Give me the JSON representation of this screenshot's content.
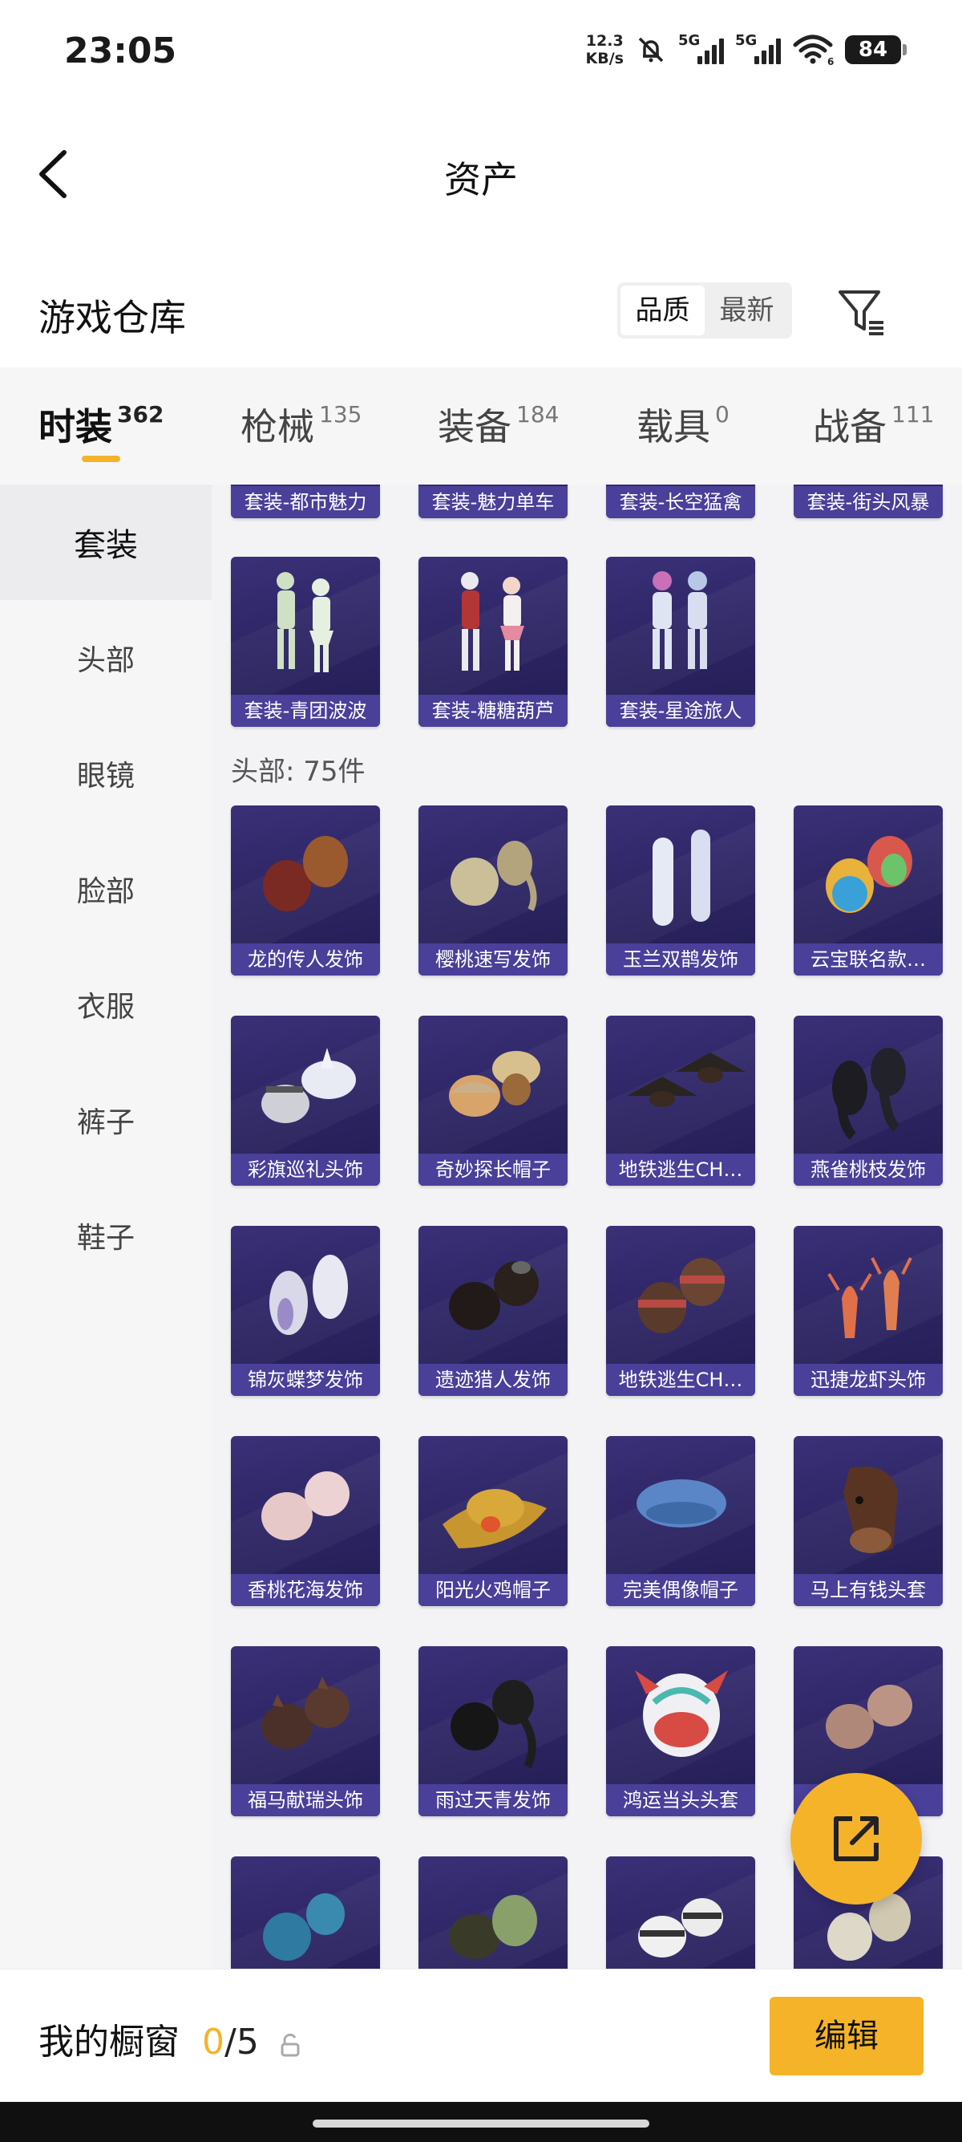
{
  "status_bar": {
    "time": "23:05",
    "net_speed_value": "12.3",
    "net_speed_unit": "KB/s",
    "sim1": "5G",
    "sim2": "5G",
    "wifi_badge": "6",
    "battery": "84"
  },
  "header": {
    "title": "资产"
  },
  "warehouse": {
    "title": "游戏仓库",
    "sort_options": [
      "品质",
      "最新"
    ],
    "sort_selected": "品质"
  },
  "tabs": [
    {
      "name": "时装",
      "count": "362",
      "active": true
    },
    {
      "name": "枪械",
      "count": "135"
    },
    {
      "name": "装备",
      "count": "184"
    },
    {
      "name": "载具",
      "count": "0"
    },
    {
      "name": "战备",
      "count": "111"
    }
  ],
  "sidebar": {
    "items": [
      "套装",
      "头部",
      "眼镜",
      "脸部",
      "衣服",
      "裤子",
      "鞋子"
    ],
    "active": "套装"
  },
  "grid": {
    "partial_row": [
      "套装-都市魅力",
      "套装-魅力单车",
      "套装-长空猛禽",
      "套装-街头风暴"
    ],
    "sets_row": [
      "套装-青团波波",
      "套装-糖糖葫芦",
      "套装-星途旅人"
    ],
    "head_section_label": "头部: 75件",
    "head_items": [
      "龙的传人发饰",
      "樱桃速写发饰",
      "玉兰双鹊发饰",
      "云宝联名款…",
      "彩旗巡礼头饰",
      "奇妙探长帽子",
      "地铁逃生CH…",
      "燕雀桃枝发饰",
      "锦灰蝶梦发饰",
      "遗迹猎人发饰",
      "地铁逃生CH…",
      "迅捷龙虾头饰",
      "香桃花海发饰",
      "阳光火鸡帽子",
      "完美偶像帽子",
      "马上有钱头套",
      "福马献瑞头饰",
      "雨过天青发饰",
      "鸿运当头头套",
      "…饰"
    ]
  },
  "bottom_bar": {
    "label": "我的橱窗",
    "count_current": "0",
    "count_total": "/5",
    "edit_label": "编辑"
  },
  "colors": {
    "accent": "#f5b32a",
    "card_bg": "#2a2360",
    "card_label_bg": "#4a3f99"
  }
}
